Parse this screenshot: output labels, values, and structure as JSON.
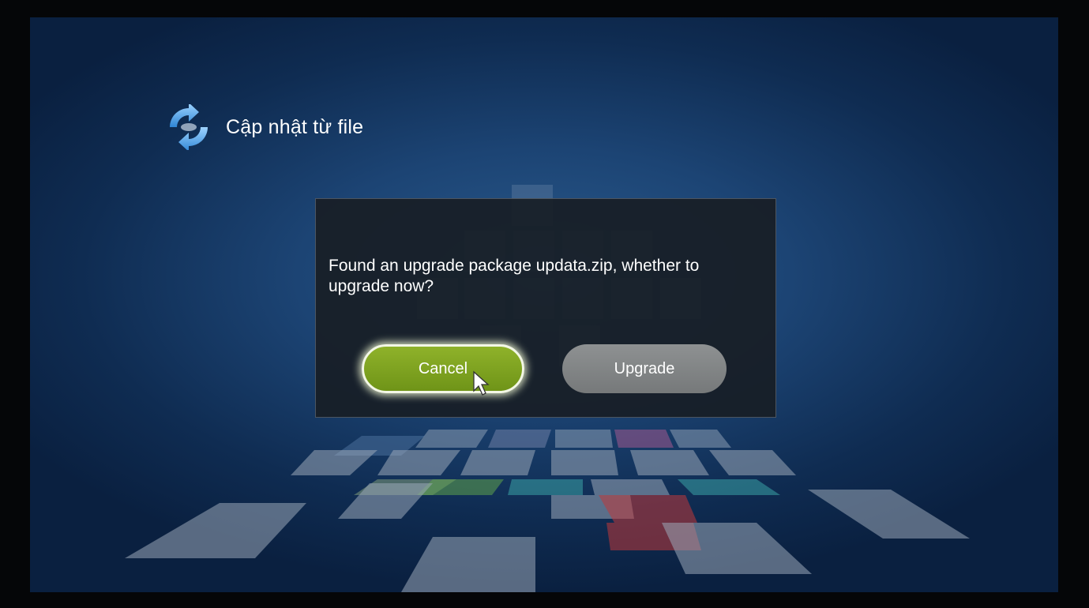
{
  "header": {
    "icon": "refresh-arrows-icon",
    "title": "Cập nhật từ file"
  },
  "dialog": {
    "message": "Found an upgrade package updata.zip, whether to upgrade now?",
    "buttons": {
      "cancel": "Cancel",
      "upgrade": "Upgrade"
    },
    "focused_button": "cancel"
  },
  "colors": {
    "background": "#1c4474",
    "cancel_button": "#7ea11f",
    "upgrade_button": "#828586",
    "dialog": "#181e26"
  }
}
